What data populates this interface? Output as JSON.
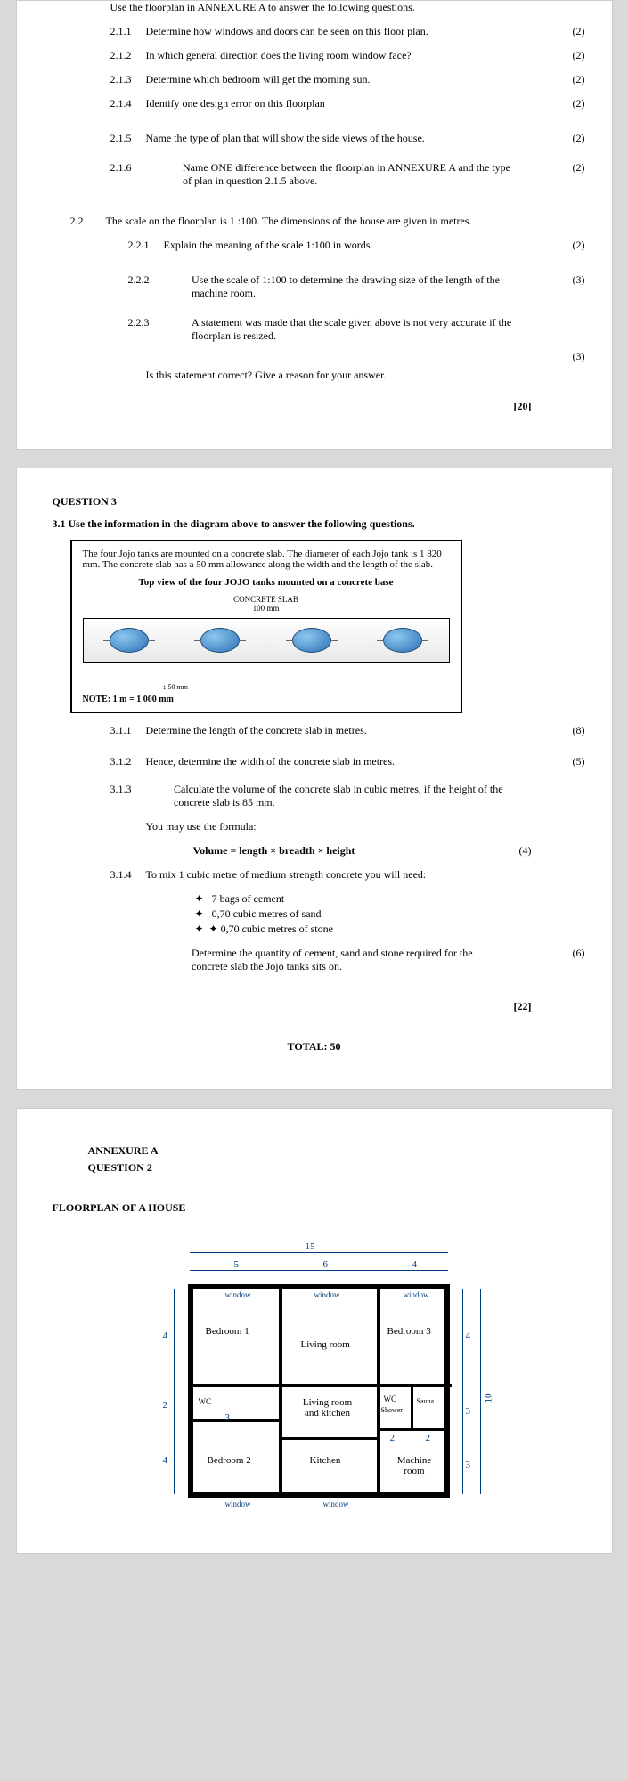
{
  "page1": {
    "intro": "Use the floorplan in ANNEXURE A to answer the following questions.",
    "q211": {
      "num": "2.1.1",
      "text": "Determine how windows and doors can be seen on this floor plan.",
      "marks": "(2)"
    },
    "q212": {
      "num": "2.1.2",
      "text": "In which general direction does the living room window face?",
      "marks": "(2)"
    },
    "q213": {
      "num": "2.1.3",
      "text": "Determine which bedroom will get the morning sun.",
      "marks": "(2)"
    },
    "q214": {
      "num": "2.1.4",
      "text": "Identify one design error on this floorplan",
      "marks": "(2)"
    },
    "q215": {
      "num": "2.1.5",
      "text": "Name the type of plan that will show the side views of the house.",
      "marks": "(2)"
    },
    "q216": {
      "num": "2.1.6",
      "text": "Name ONE difference between the floorplan in ANNEXURE A and the type of plan in question 2.1.5 above.",
      "marks": "(2)"
    },
    "q22_num": "2.2",
    "q22_intro": "The scale on the floorplan is 1 :100. The dimensions of the house are given in  metres.",
    "q221": {
      "num": "2.2.1",
      "text": "Explain the meaning of the scale 1:100 in words.",
      "marks": "(2)"
    },
    "q222": {
      "num": "2.2.2",
      "text": "Use the scale of 1:100 to determine the drawing size of the length of the machine room.",
      "marks": "(3)"
    },
    "q223": {
      "num": "2.2.3",
      "text": "A statement was made that the scale given above is not very accurate if the floorplan is resized.",
      "marks": "(3)"
    },
    "q223_sub": "Is this statement correct? Give a reason for your answer.",
    "total": "[20]"
  },
  "page2": {
    "q3": "QUESTION 3",
    "q31": "3.1 Use the information in the diagram above to answer the following questions.",
    "box_text": "The four Jojo tanks are mounted on a concrete slab. The diameter of each Jojo tank is 1 820 mm.  The concrete slab has a 50 mm allowance along the width and the length of the slab.",
    "diagram_title": "Top view of the four JOJO tanks mounted on a concrete base",
    "slab_label1": "CONCRETE SLAB",
    "slab_label2": "100 mm",
    "dim50": "50 mm",
    "note": "NOTE:   1 m = 1 000 mm",
    "q311": {
      "num": "3.1.1",
      "text": "Determine the length of the concrete slab in metres.",
      "marks": "(8)"
    },
    "q312": {
      "num": "3.1.2",
      "text": "Hence, determine the width of the concrete slab in metres.",
      "marks": "(5)"
    },
    "q313": {
      "num": "3.1.3",
      "text": "Calculate the volume of the concrete slab in cubic metres, if the height of the concrete slab is 85 mm.",
      "marks": "(4)"
    },
    "q313_sub": "You may use the formula:",
    "formula": "Volume = length × breadth × height",
    "q314": {
      "num": "3.1.4",
      "text": "To mix 1 cubic metre of medium strength concrete you will need:"
    },
    "b1": "7 bags of cement",
    "b2": "0,70 cubic metres of sand",
    "b3": "0,70 cubic metres of stone",
    "q314_end": "Determine the quantity of cement, sand and stone required for the concrete slab the Jojo tanks sits on.",
    "q314_marks": "(6)",
    "section_total": "[22]",
    "total": "TOTAL: 50"
  },
  "page3": {
    "annex": "ANNEXURE A",
    "annex_q": "QUESTION 2",
    "title": "FLOORPLAN OF A HOUSE",
    "dims": {
      "d15": "15",
      "d5": "5",
      "d6": "6",
      "d4": "4",
      "d4b": "4",
      "d2": "2",
      "d4c": "4",
      "d3": "3",
      "d4d": "4",
      "d3b": "3",
      "d3c": "3",
      "d2b": "2",
      "d2c": "2",
      "d10": "10"
    },
    "rooms": {
      "bed1": "Bedroom  1",
      "bed2": "Bedroom 2",
      "bed3": "Bedroom 3",
      "living": "Living room",
      "living_kitchen": "Living room and kitchen",
      "kitchen": "Kitchen",
      "wc1": "WC",
      "wc2": "WC",
      "shower": "Shower",
      "sauna": "Sauna",
      "machine": "Machine room"
    },
    "window_label": "window"
  }
}
